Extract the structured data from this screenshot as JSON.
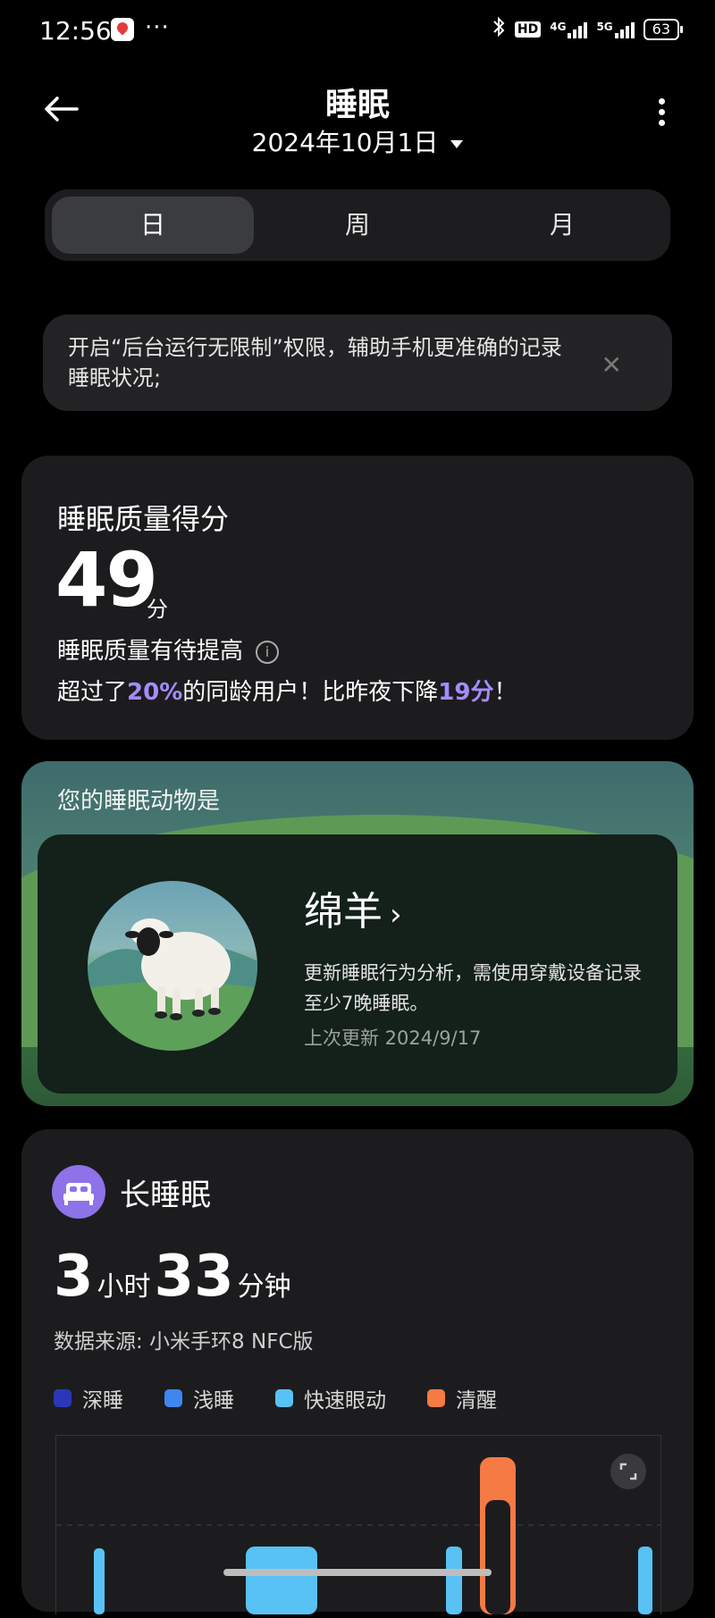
{
  "status_bar": {
    "time": "12:56",
    "dots": "···",
    "hd": "HD",
    "net1": "4G",
    "net2": "5G",
    "battery": "63"
  },
  "header": {
    "title": "睡眠",
    "date": "2024年10月1日"
  },
  "tabs": [
    {
      "label": "日"
    },
    {
      "label": "周"
    },
    {
      "label": "月"
    }
  ],
  "banner": {
    "text": "开启“后台运行无限制”权限，辅助手机更准确的记录睡眠状况;",
    "close": "✕"
  },
  "score": {
    "heading": "睡眠质量得分",
    "value": "49",
    "unit": "分",
    "quality": "睡眠质量有待提高",
    "cmp_prefix": "超过了",
    "cmp_pct": "20%",
    "cmp_mid": "的同龄用户！比昨夜下降",
    "cmp_drop": "19分",
    "cmp_suffix": "！"
  },
  "animal": {
    "heading": "您的睡眠动物是",
    "name": "绵羊",
    "desc": "更新睡眠行为分析，需使用穿戴设备记录至少7晚睡眠。",
    "updated": "上次更新 2024/9/17"
  },
  "long_sleep": {
    "title": "长睡眠",
    "hours": "3",
    "hours_unit": "小时",
    "minutes": "33",
    "minutes_unit": "分钟",
    "source": "数据来源: 小米手环8 NFC版",
    "legend": [
      {
        "label": "深睡",
        "color": "#2b37b8"
      },
      {
        "label": "浅睡",
        "color": "#3e86f0"
      },
      {
        "label": "快速眼动",
        "color": "#58c2f5"
      },
      {
        "label": "清醒",
        "color": "#f67a44"
      }
    ]
  }
}
